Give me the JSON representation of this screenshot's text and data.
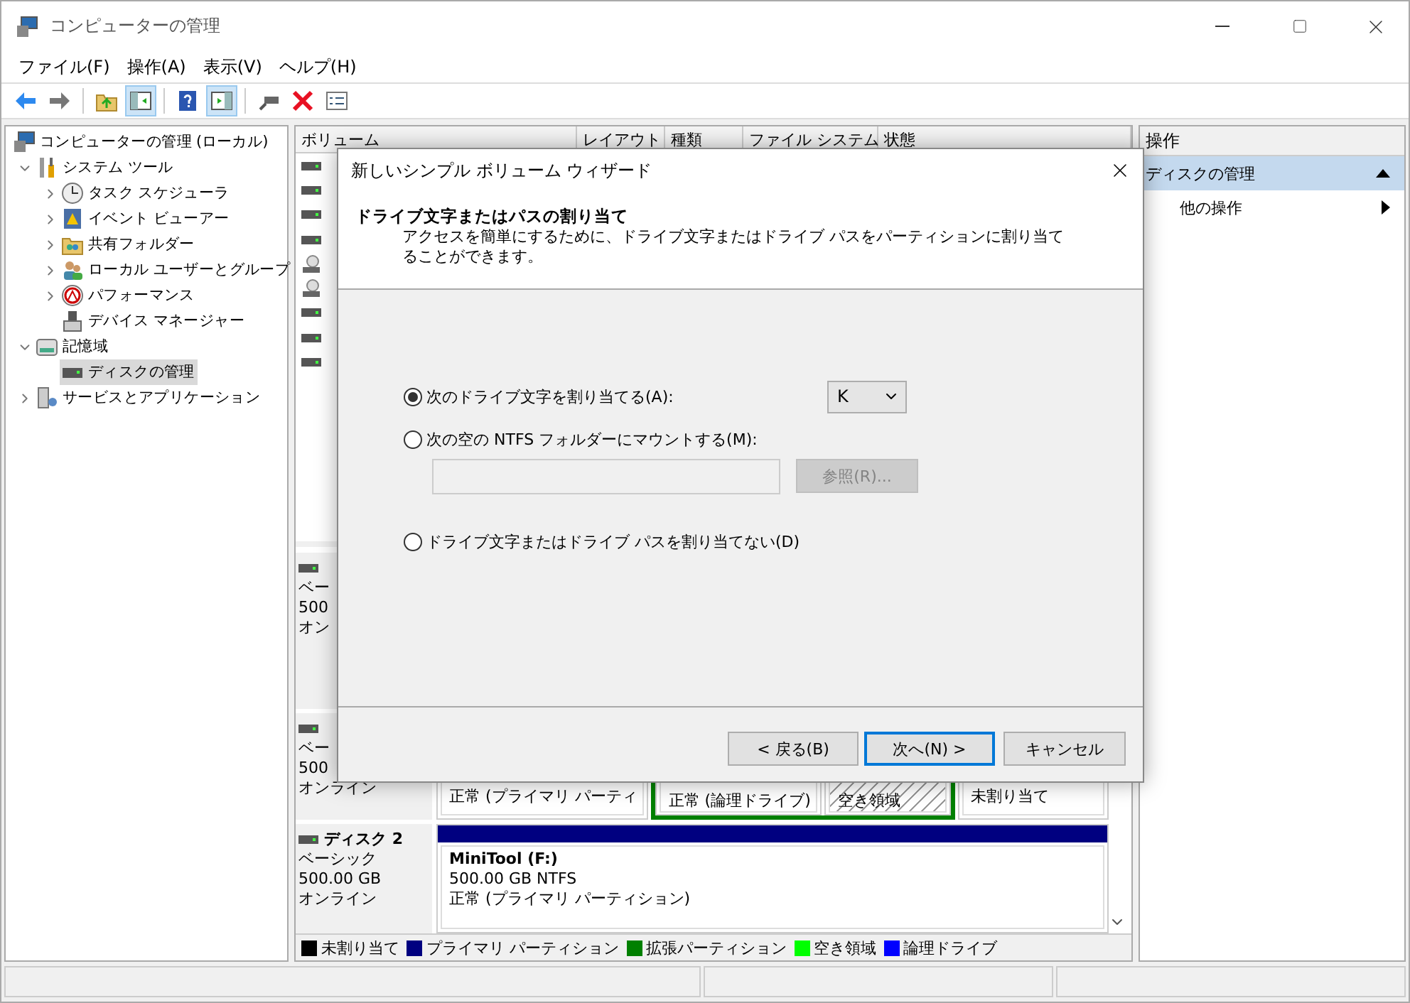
{
  "window": {
    "title": "コンピューターの管理"
  },
  "menu": [
    {
      "label": "ファイル(F)"
    },
    {
      "label": "操作(A)"
    },
    {
      "label": "表示(V)"
    },
    {
      "label": "ヘルプ(H)"
    }
  ],
  "toolbar": [
    {
      "kind": "back",
      "pressed": false
    },
    {
      "kind": "forward",
      "pressed": false
    },
    {
      "kind": "separator"
    },
    {
      "kind": "up",
      "pressed": false
    },
    {
      "kind": "tree",
      "pressed": true
    },
    {
      "kind": "separator"
    },
    {
      "kind": "help",
      "pressed": false
    },
    {
      "kind": "actionpane",
      "pressed": true
    },
    {
      "kind": "separator"
    },
    {
      "kind": "connect",
      "pressed": false
    },
    {
      "kind": "delete",
      "pressed": false
    },
    {
      "kind": "properties",
      "pressed": false
    }
  ],
  "tree": [
    {
      "label": "コンピューターの管理 (ローカル)",
      "kind": "computer",
      "selected": false,
      "children": [
        {
          "label": "システム ツール",
          "kind": "tools",
          "selected": false,
          "expanded": true,
          "children": [
            {
              "label": "タスク スケジューラ",
              "kind": "clock",
              "selected": false,
              "expanded": false
            },
            {
              "label": "イベント ビューアー",
              "kind": "event",
              "selected": false,
              "expanded": false
            },
            {
              "label": "共有フォルダー",
              "kind": "share",
              "selected": false,
              "expanded": false
            },
            {
              "label": "ローカル ユーザーとグループ",
              "kind": "users",
              "selected": false,
              "expanded": false
            },
            {
              "label": "パフォーマンス",
              "kind": "perf",
              "selected": false,
              "expanded": false
            },
            {
              "label": "デバイス マネージャー",
              "kind": "device",
              "selected": false
            }
          ]
        },
        {
          "label": "記憶域",
          "kind": "storage",
          "selected": false,
          "expanded": true,
          "children": [
            {
              "label": "ディスクの管理",
              "kind": "disk",
              "selected": true
            }
          ]
        },
        {
          "label": "サービスとアプリケーション",
          "kind": "services",
          "selected": false,
          "expanded": false
        }
      ]
    }
  ],
  "volume_table": {
    "columns": [
      "ボリューム",
      "レイアウト",
      "種類",
      "ファイル システム",
      "状態"
    ],
    "rows": [
      {
        "kind": "disk"
      },
      {
        "kind": "disk"
      },
      {
        "kind": "disk"
      },
      {
        "kind": "disk"
      },
      {
        "kind": "optical"
      },
      {
        "kind": "optical"
      },
      {
        "kind": "disk"
      },
      {
        "kind": "disk"
      },
      {
        "kind": "disk"
      }
    ]
  },
  "disks": [
    {
      "info": [
        "ベー",
        "500",
        "オン"
      ]
    },
    {
      "info": [
        "ベー",
        "500",
        "オンライン"
      ],
      "partitions": [
        {
          "kind": "primary",
          "status": "正常 (プライマリ パーティ"
        },
        {
          "kind": "extended",
          "children": [
            {
              "kind": "logical",
              "status": "正常 (論理ドライブ)"
            },
            {
              "kind": "free",
              "status": "空き領域"
            }
          ]
        },
        {
          "kind": "unallocated",
          "status": "未割り当て"
        }
      ]
    },
    {
      "name": "ディスク 2",
      "info": [
        "ベーシック",
        "500.00 GB",
        "オンライン"
      ],
      "partitions": [
        {
          "kind": "primary",
          "name": "MiniTool  (F:)",
          "size": "500.00 GB NTFS",
          "status": "正常 (プライマリ パーティション)"
        }
      ]
    }
  ],
  "legend": [
    {
      "label": "未割り当て",
      "color": "#000000"
    },
    {
      "label": "プライマリ パーティション",
      "color": "#000080"
    },
    {
      "label": "拡張パーティション",
      "color": "#008000"
    },
    {
      "label": "空き領域",
      "color": "#00ff00"
    },
    {
      "label": "論理ドライブ",
      "color": "#0000ff"
    }
  ],
  "actions": {
    "title": "操作",
    "items": [
      {
        "label": "ディスクの管理",
        "kind": "section",
        "selected": true
      },
      {
        "label": "他の操作",
        "kind": "submenu",
        "selected": false
      }
    ]
  },
  "dialog": {
    "title": "新しいシンプル ボリューム ウィザード",
    "heading": "ドライブ文字またはパスの割り当て",
    "description": "アクセスを簡単にするために、ドライブ文字またはドライブ パスをパーティションに割り当てることができます。",
    "options": [
      {
        "kind": "letter",
        "label": "次のドライブ文字を割り当てる(A):",
        "selected": true,
        "value": "K"
      },
      {
        "kind": "folder",
        "label": "次の空の NTFS フォルダーにマウントする(M):",
        "selected": false,
        "browse": {
          "label": "参照(R)...",
          "disabled": true
        }
      },
      {
        "kind": "none",
        "label": "ドライブ文字またはドライブ パスを割り当てない(D)",
        "selected": false
      }
    ],
    "buttons": [
      {
        "label": "< 戻る(B)",
        "default": false
      },
      {
        "label": "次へ(N) >",
        "default": true
      },
      {
        "label": "キャンセル",
        "default": false
      }
    ]
  }
}
